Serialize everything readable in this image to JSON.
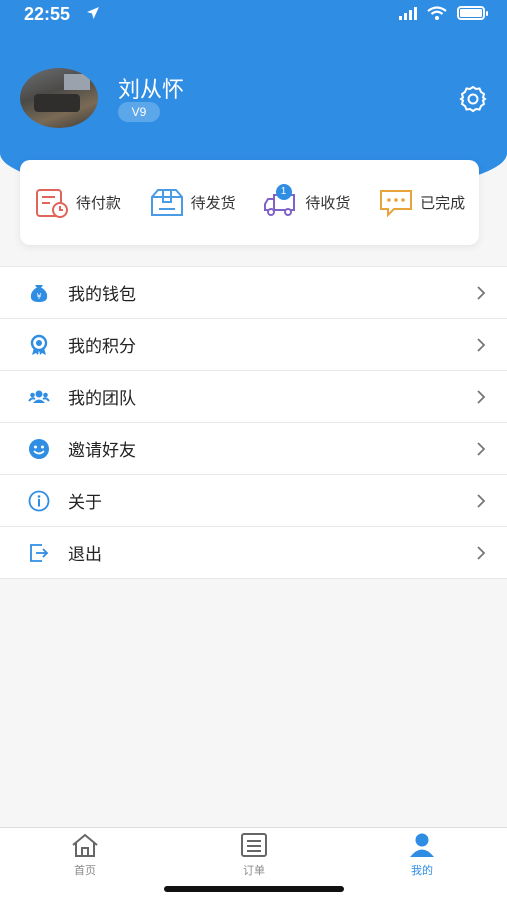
{
  "status": {
    "time": "22:55"
  },
  "profile": {
    "name": "刘从怀",
    "level": "V9"
  },
  "orders": [
    {
      "label": "待付款",
      "icon": "pending-payment-icon",
      "color": "#e0645a"
    },
    {
      "label": "待发货",
      "icon": "pending-shipment-icon",
      "color": "#4a9be6"
    },
    {
      "label": "待收货",
      "icon": "pending-receipt-icon",
      "color": "#7f63c8",
      "badge": "1"
    },
    {
      "label": "已完成",
      "icon": "completed-icon",
      "color": "#e8a33a"
    }
  ],
  "menu": [
    {
      "label": "我的钱包",
      "icon": "wallet-icon"
    },
    {
      "label": "我的积分",
      "icon": "points-icon"
    },
    {
      "label": "我的团队",
      "icon": "team-icon"
    },
    {
      "label": "邀请好友",
      "icon": "invite-icon"
    },
    {
      "label": "关于",
      "icon": "info-icon"
    },
    {
      "label": "退出",
      "icon": "logout-icon"
    }
  ],
  "tabbar": [
    {
      "label": "首页",
      "icon": "home-icon"
    },
    {
      "label": "订单",
      "icon": "orders-icon"
    },
    {
      "label": "我的",
      "icon": "profile-icon",
      "active": true
    }
  ],
  "colors": {
    "primary": "#2f8de4",
    "background": "#f6f6f6"
  }
}
